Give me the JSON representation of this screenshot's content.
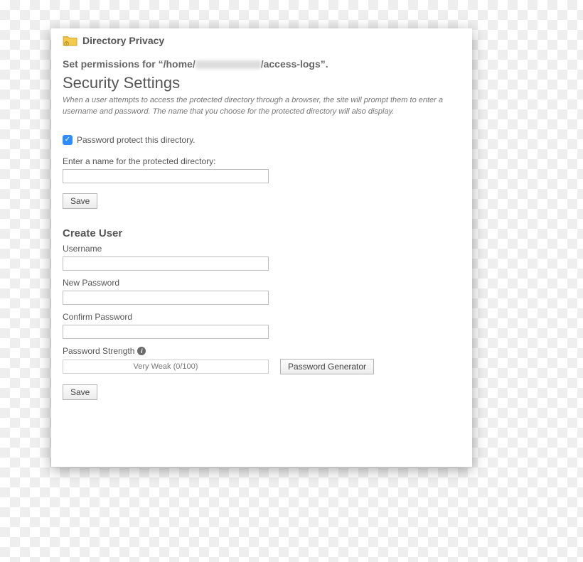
{
  "header": {
    "title": "Directory Privacy"
  },
  "permissions": {
    "prefix": "Set permissions for “/home/",
    "suffix": "/access-logs”."
  },
  "security": {
    "heading": "Security Settings",
    "description": "When a user attempts to access the protected directory through a browser, the site will prompt them to enter a username and password. The name that you choose for the protected directory will also display.",
    "checkbox_label": "Password protect this directory.",
    "name_label": "Enter a name for the protected directory:",
    "name_value": "",
    "save_label": "Save"
  },
  "create_user": {
    "heading": "Create User",
    "username_label": "Username",
    "username_value": "",
    "new_password_label": "New Password",
    "new_password_value": "",
    "confirm_password_label": "Confirm Password",
    "confirm_password_value": "",
    "strength_label": "Password Strength",
    "strength_value": "Very Weak (0/100)",
    "generator_label": "Password Generator",
    "save_label": "Save"
  }
}
